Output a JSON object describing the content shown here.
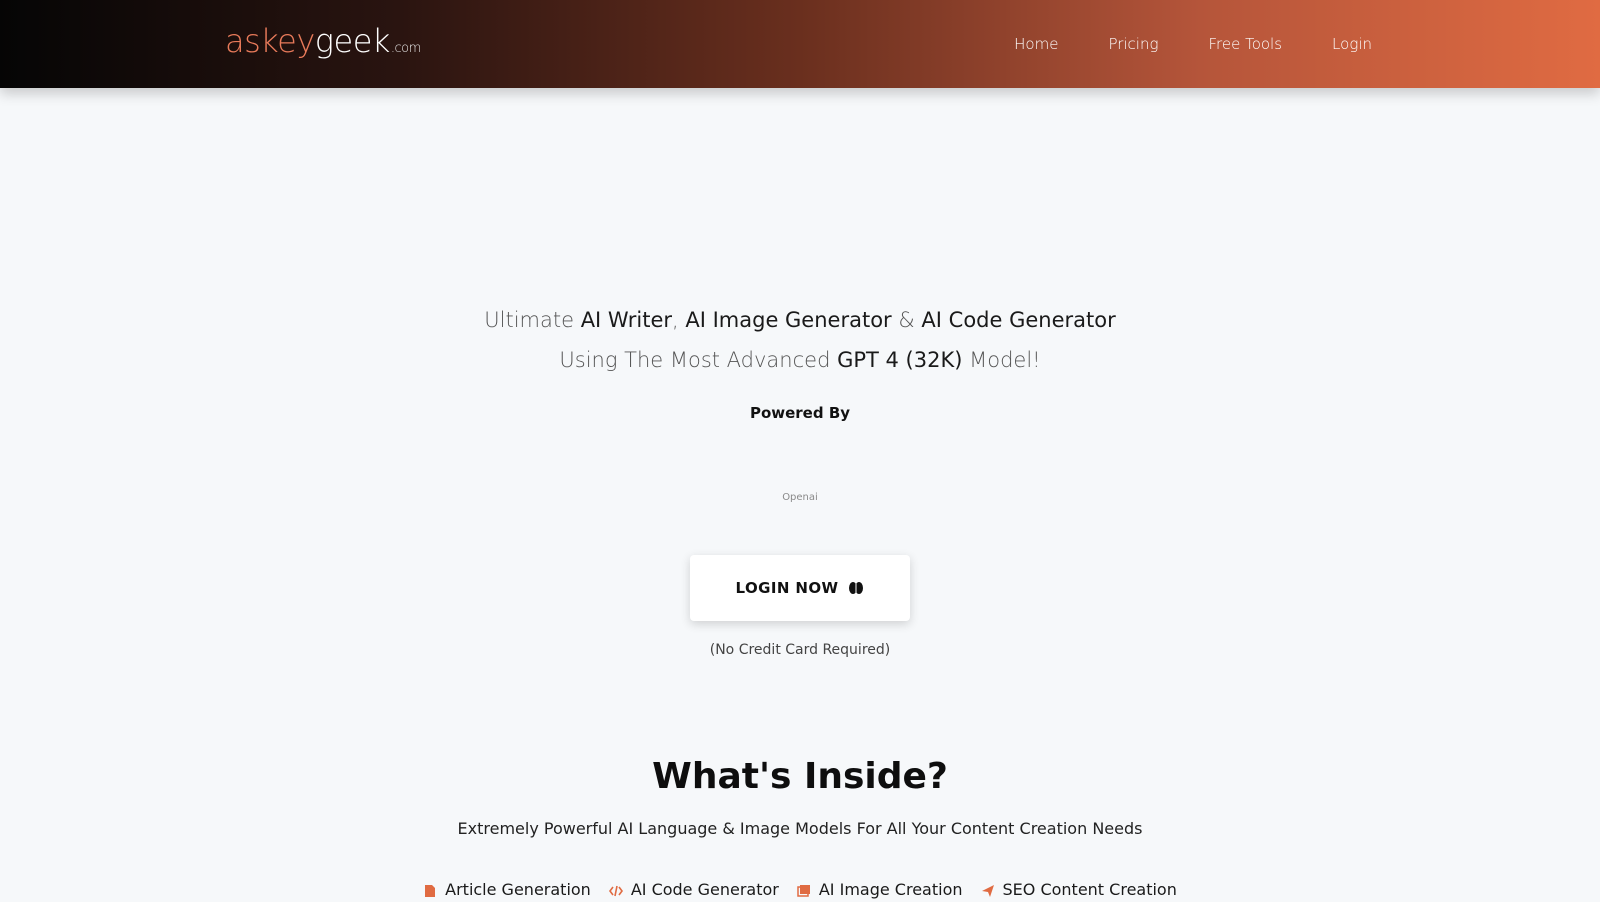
{
  "header": {
    "logo": {
      "part1": "askey",
      "part2": "geek",
      "part3": ".com"
    },
    "nav": [
      "Home",
      "Pricing",
      "Free Tools",
      "Login"
    ]
  },
  "hero": {
    "line1": {
      "a": "Ultimate ",
      "b": "AI Writer",
      "c": ", ",
      "d": "AI Image Generator",
      "e": " & ",
      "f": "AI Code Generator"
    },
    "line2": {
      "a": "Using The Most Advanced ",
      "b": "GPT 4 (32K)",
      "c": " Model!"
    },
    "powered_by": "Powered By",
    "powered_logo_text": "Openai",
    "cta_label": "LOGIN NOW",
    "cta_icon": "brain-icon",
    "cta_note": "(No Credit Card Required)"
  },
  "inside": {
    "title": "What's Inside?",
    "subtitle": "Extremely Powerful AI Language & Image Models For All Your Content Creation Needs",
    "features": [
      {
        "icon": "article-icon",
        "label": "Article Generation"
      },
      {
        "icon": "code-icon",
        "label": "AI Code Generator"
      },
      {
        "icon": "image-icon",
        "label": "AI Image Creation"
      },
      {
        "icon": "paper-plane-icon",
        "label": "SEO Content Creation"
      }
    ]
  },
  "colors": {
    "accent": "#e06b42",
    "nav_gradient_start": "#050505",
    "nav_gradient_end": "#e06b42",
    "background": "#f6f8fa"
  }
}
